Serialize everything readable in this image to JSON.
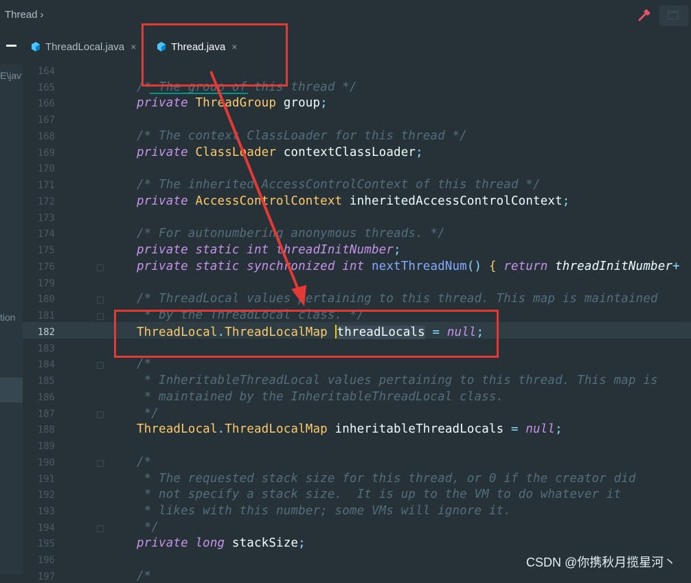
{
  "breadcrumb": {
    "label": "Thread"
  },
  "tabs": [
    {
      "label": "ThreadLocal.java",
      "active": false,
      "close": "×"
    },
    {
      "label": "Thread.java",
      "active": true,
      "close": "×"
    }
  ],
  "left_panel": {
    "fragment_top": "E\\jav",
    "fragment_mid": "tion"
  },
  "editor": {
    "lines": [
      {
        "n": "164",
        "html": ""
      },
      {
        "n": "165",
        "html": "<span class='cm'>/* The group of this thread */</span>"
      },
      {
        "n": "166",
        "html": "<span class='kw'>private</span> <span class='ty'>ThreadGroup</span> group<span class='pu'>;</span>"
      },
      {
        "n": "167",
        "html": ""
      },
      {
        "n": "168",
        "html": "<span class='cm'>/* The context ClassLoader for this thread */</span>"
      },
      {
        "n": "169",
        "html": "<span class='kw'>private</span> <span class='ty'>ClassLoader</span> contextClassLoader<span class='pu'>;</span>"
      },
      {
        "n": "170",
        "html": ""
      },
      {
        "n": "171",
        "html": "<span class='cm'>/* The inherited AccessControlContext of this thread */</span>"
      },
      {
        "n": "172",
        "html": "<span class='kw'>private</span> <span class='ty'>AccessControlContext</span> inheritedAccessControlContext<span class='pu'>;</span>"
      },
      {
        "n": "173",
        "html": ""
      },
      {
        "n": "174",
        "html": "<span class='cm'>/* For autonumbering anonymous threads. */</span>"
      },
      {
        "n": "175",
        "html": "<span class='kw'>private static int</span> <span class='kw'>threadInitNumber</span><span class='pu'>;</span>"
      },
      {
        "n": "176",
        "html": "<span class='kw'>private static synchronized int</span> <span class='fn'>nextThreadNum</span><span class='pu'>()</span> <span class='ty'>{</span> <span class='kw'>return</span> <span style='font-style:italic'>threadInitNumber</span><span class='pu'>+</span>"
      },
      {
        "n": "179",
        "html": ""
      },
      {
        "n": "180",
        "html": "<span class='cm'>/* ThreadLocal values pertaining to this thread. This map is maintained</span>"
      },
      {
        "n": "181",
        "html": "<span class='cm'> * by the ThreadLocal class. */</span>"
      },
      {
        "n": "182",
        "html": "<span class='ty'>ThreadLocal</span><span class='pu'>.</span><span class='ty'>ThreadLocalMap</span> <span class='caret'></span><span class='sel'>threadLocals</span> <span class='pu'>=</span> <span class='kw'>null</span><span class='pu'>;</span>"
      },
      {
        "n": "183",
        "html": ""
      },
      {
        "n": "184",
        "html": "<span class='cm'>/*</span>"
      },
      {
        "n": "185",
        "html": "<span class='cm'> * InheritableThreadLocal values pertaining to this thread. This map is</span>"
      },
      {
        "n": "186",
        "html": "<span class='cm'> * maintained by the InheritableThreadLocal class.</span>"
      },
      {
        "n": "187",
        "html": "<span class='cm'> */</span>"
      },
      {
        "n": "188",
        "html": "<span class='ty'>ThreadLocal</span><span class='pu'>.</span><span class='ty'>ThreadLocalMap</span> inheritableThreadLocals <span class='pu'>=</span> <span class='kw'>null</span><span class='pu'>;</span>"
      },
      {
        "n": "189",
        "html": ""
      },
      {
        "n": "190",
        "html": "<span class='cm'>/*</span>"
      },
      {
        "n": "191",
        "html": "<span class='cm'> * The requested stack size for this thread, or 0 if the creator did</span>"
      },
      {
        "n": "192",
        "html": "<span class='cm'> * not specify a stack size.  It is up to the VM to do whatever it</span>"
      },
      {
        "n": "193",
        "html": "<span class='cm'> * likes with this number; some VMs will ignore it.</span>"
      },
      {
        "n": "194",
        "html": "<span class='cm'> */</span>"
      },
      {
        "n": "195",
        "html": "<span class='kw'>private long</span> stackSize<span class='pu'>;</span>"
      },
      {
        "n": "196",
        "html": ""
      },
      {
        "n": "197",
        "html": "<span class='cm'>/*</span>"
      }
    ]
  },
  "watermark": "CSDN @你携秋月揽星河丶",
  "colors": {
    "background": "#263238",
    "accent": "#009688",
    "annotation": "#e53935"
  }
}
